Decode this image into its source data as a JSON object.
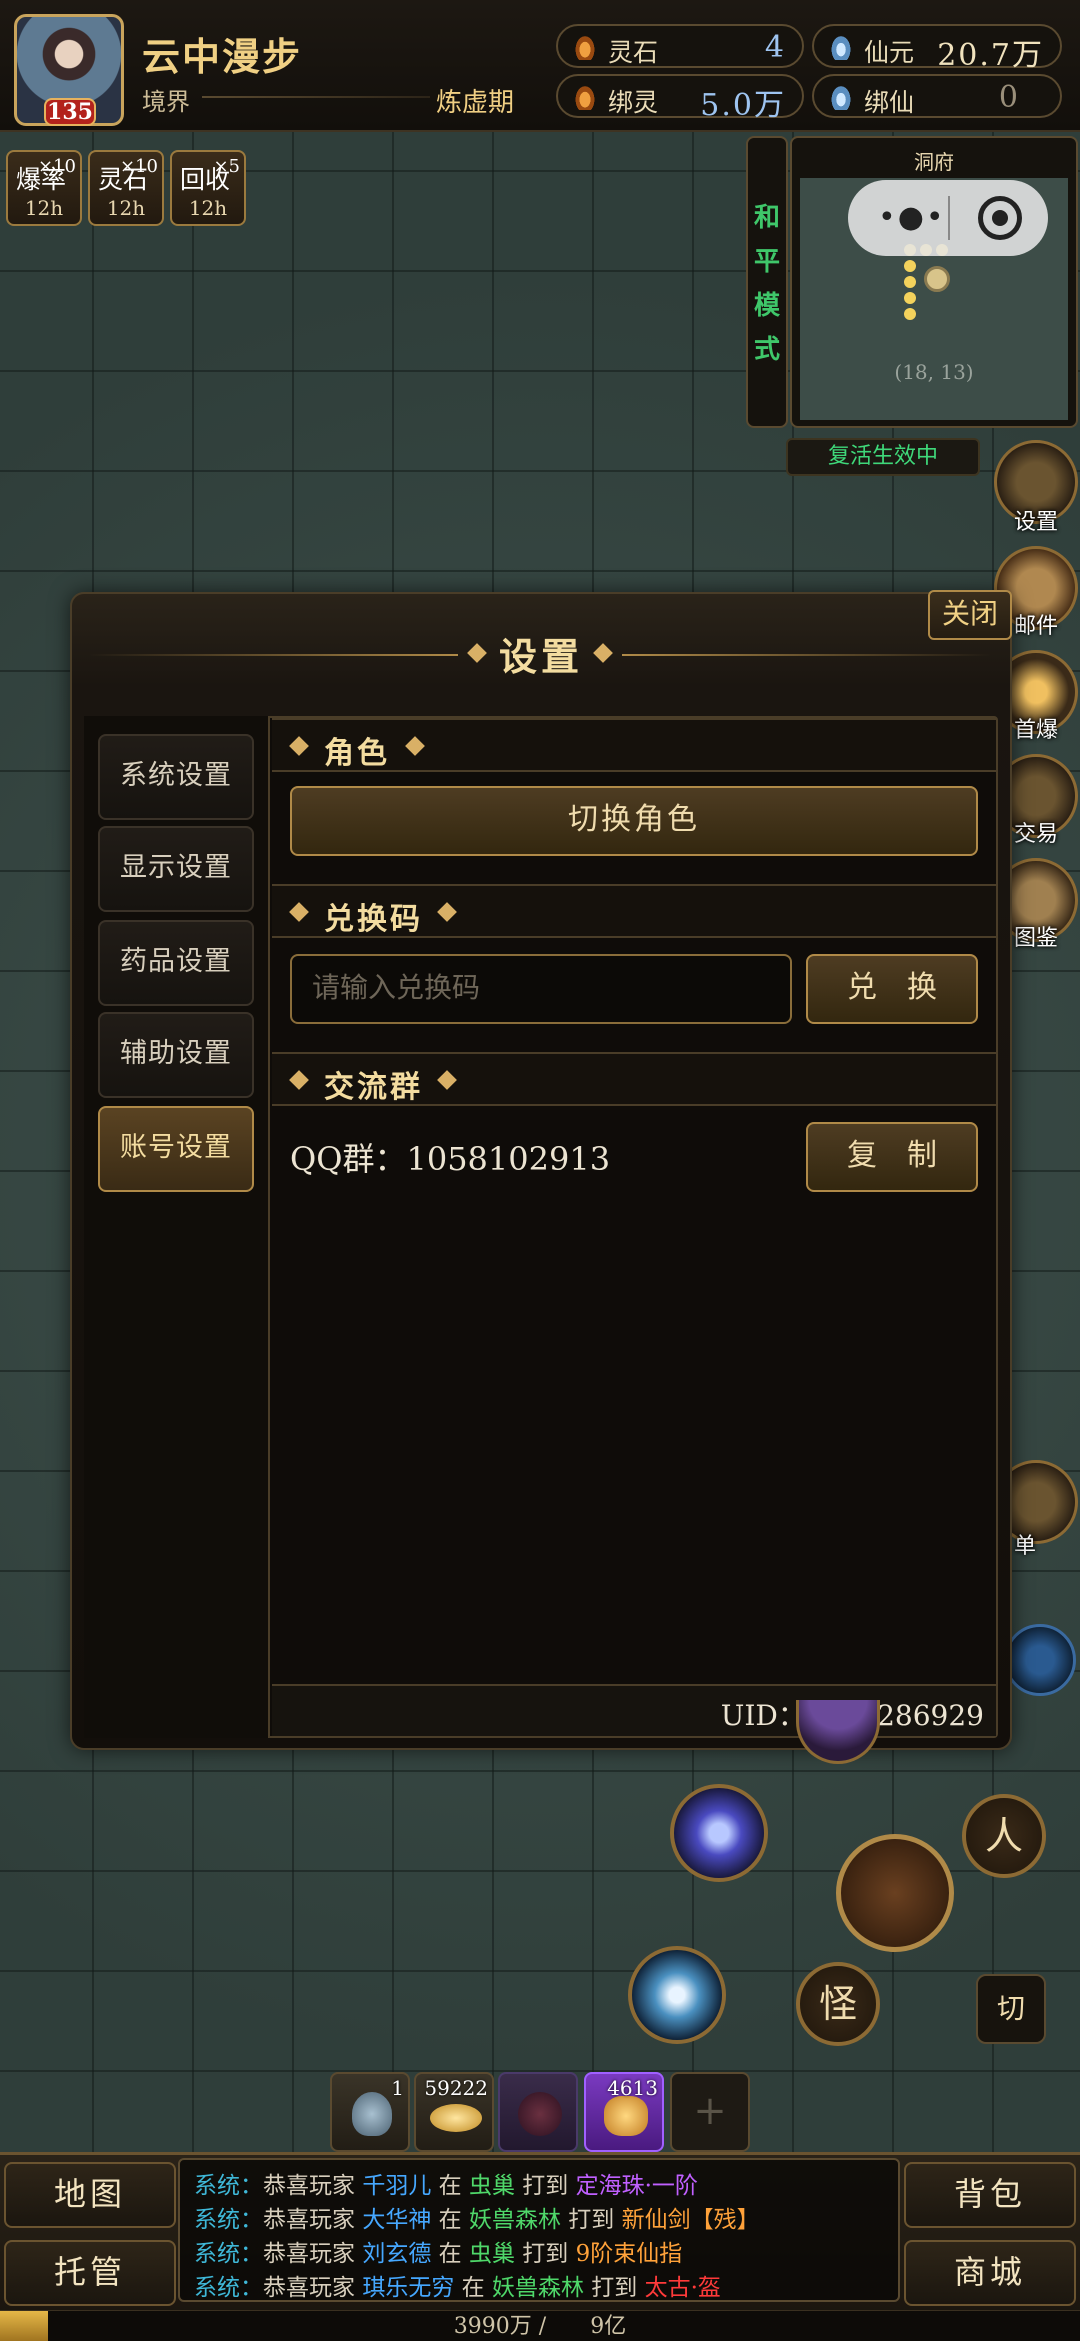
{
  "player": {
    "name": "云中漫步",
    "level": "135",
    "realm_label": "境界",
    "realm_value": "炼虚期"
  },
  "resources": [
    {
      "label": "灵石",
      "value": "4",
      "icon": "spirit-stone-icon"
    },
    {
      "label": "仙元",
      "value": "20.7万",
      "icon": "ingot-icon"
    },
    {
      "label": "绑灵",
      "value": "5.0万",
      "icon": "bound-spirit-icon"
    },
    {
      "label": "绑仙",
      "value": "0",
      "icon": "ingot-icon"
    }
  ],
  "buffs": [
    {
      "name": "爆率",
      "mult": "×10",
      "time": "12h"
    },
    {
      "name": "灵石",
      "mult": "×10",
      "time": "12h"
    },
    {
      "name": "回收",
      "mult": "×5",
      "time": "12h"
    }
  ],
  "mode": {
    "chars": [
      "和",
      "平",
      "模",
      "式"
    ]
  },
  "minimap": {
    "title": "洞府",
    "coord": "(18, 13)"
  },
  "revive_status": "复活生效中",
  "side_menu": [
    "设置",
    "邮件",
    "首爆",
    "交易",
    "图鉴",
    "单"
  ],
  "dialog": {
    "title": "设置",
    "close": "关闭",
    "nav": [
      "系统设置",
      "显示设置",
      "药品设置",
      "辅助设置",
      "账号设置"
    ],
    "active_nav": "账号设置",
    "sections": {
      "role": {
        "title": "角色",
        "button": "切换角色"
      },
      "code": {
        "title": "兑换码",
        "placeholder": "请输入兑换码",
        "button": "兑　换"
      },
      "group": {
        "title": "交流群",
        "qq": "QQ群：1058102913",
        "button": "复　制"
      }
    },
    "uid": "UID：1045286929"
  },
  "actions": {
    "person": "人",
    "monster": "怪",
    "switch": "切"
  },
  "quickbar": [
    {
      "count": "1",
      "icon": "rune-stone-icon"
    },
    {
      "count": "59222",
      "icon": "gold-ingot-icon"
    },
    {
      "count": "",
      "icon": "dark-orb-icon"
    },
    {
      "count": "4613",
      "icon": "gold-pouch-icon"
    },
    {
      "count": "",
      "icon": "plus-icon",
      "symbol": "+"
    }
  ],
  "bottom": {
    "map": "地图",
    "auto": "托管",
    "bag": "背包",
    "shop": "商城"
  },
  "chat": [
    [
      {
        "t": "系统：",
        "c": "sys"
      },
      {
        "t": "恭喜玩家 ",
        "c": "txt"
      },
      {
        "t": "千羽儿",
        "c": "blue"
      },
      {
        "t": " 在 ",
        "c": "txt"
      },
      {
        "t": "虫巢",
        "c": "green"
      },
      {
        "t": " 打到 ",
        "c": "txt"
      },
      {
        "t": "定海珠·一阶",
        "c": "purple"
      }
    ],
    [
      {
        "t": "系统：",
        "c": "sys"
      },
      {
        "t": "恭喜玩家 ",
        "c": "txt"
      },
      {
        "t": "大华神",
        "c": "blue"
      },
      {
        "t": " 在 ",
        "c": "txt"
      },
      {
        "t": "妖兽森林",
        "c": "green"
      },
      {
        "t": " 打到 ",
        "c": "txt"
      },
      {
        "t": "新仙剑【残】",
        "c": "orange"
      }
    ],
    [
      {
        "t": "系统：",
        "c": "sys"
      },
      {
        "t": "恭喜玩家 ",
        "c": "txt"
      },
      {
        "t": "刘玄德",
        "c": "blue"
      },
      {
        "t": " 在 ",
        "c": "txt"
      },
      {
        "t": "虫巢",
        "c": "green"
      },
      {
        "t": " 打到 ",
        "c": "txt"
      },
      {
        "t": "9阶束仙指",
        "c": "orange"
      }
    ],
    [
      {
        "t": "系统：",
        "c": "sys"
      },
      {
        "t": "恭喜玩家 ",
        "c": "txt"
      },
      {
        "t": "琪乐无穷",
        "c": "blue"
      },
      {
        "t": " 在 ",
        "c": "txt"
      },
      {
        "t": "妖兽森林",
        "c": "green"
      },
      {
        "t": " 打到 ",
        "c": "txt"
      },
      {
        "t": "太古·盔",
        "c": "red"
      }
    ]
  ],
  "exp": {
    "text": "3990万 /　　9亿",
    "fraction": 0.0443
  },
  "colors": {
    "accent_gold": "#f0d084",
    "mode_green": "#3fc76a",
    "dialog_bg": "#120e0a"
  }
}
